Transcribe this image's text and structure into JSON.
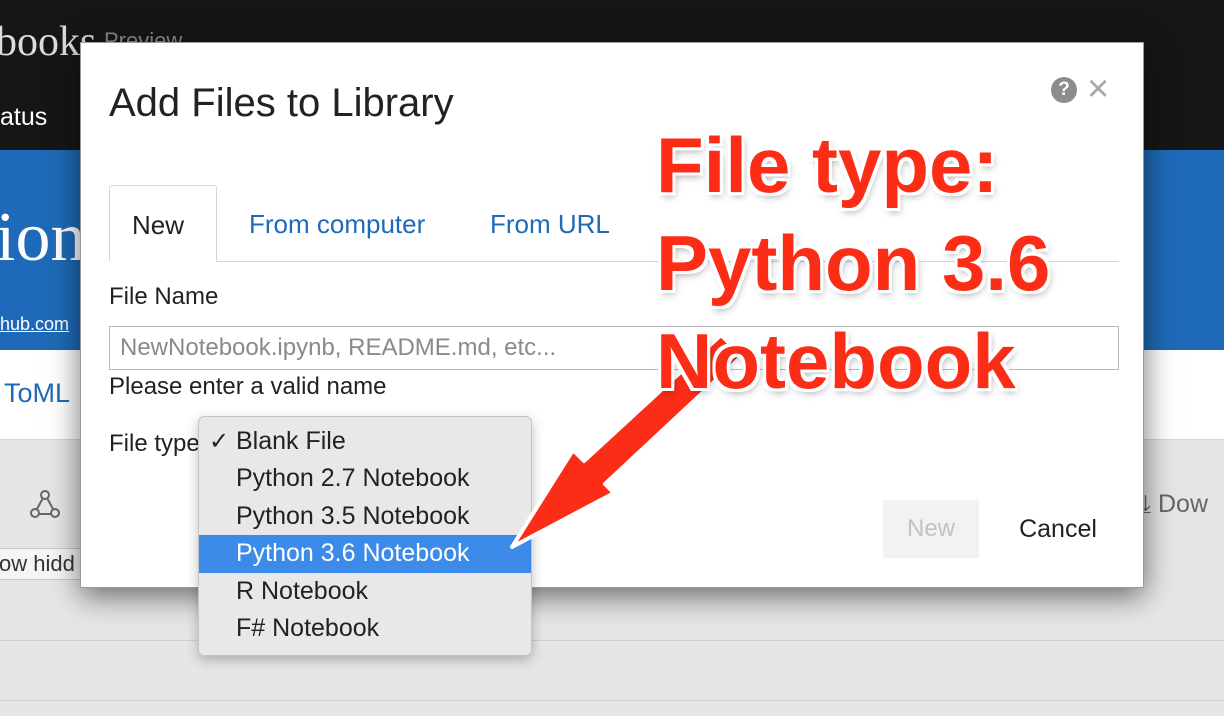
{
  "background": {
    "brand": "books",
    "preview": "Preview",
    "nav_status": "atus",
    "hero_title": "ion",
    "hero_link": "hub.com",
    "project_name": "ToML",
    "show_hidden": "ow hidd",
    "download": "Dow"
  },
  "modal": {
    "title": "Add Files to Library",
    "help_icon": "?",
    "close_icon": "×",
    "tabs": [
      {
        "label": "New"
      },
      {
        "label": "From computer"
      },
      {
        "label": "From URL"
      }
    ],
    "file_name_label": "File Name",
    "file_name_placeholder": "NewNotebook.ipynb, README.md, etc...",
    "file_name_value": "",
    "error_message": "Please enter a valid name",
    "file_type_label": "File type",
    "new_button": "New",
    "cancel_button": "Cancel"
  },
  "dropdown": {
    "check_mark": "✓",
    "checked_item": "Blank File",
    "highlighted_item": "Python 3.6 Notebook",
    "options": [
      "Blank File",
      "Python 2.7 Notebook",
      "Python 3.5 Notebook",
      "Python 3.6 Notebook",
      "R Notebook",
      "F# Notebook"
    ]
  },
  "annotation": {
    "lines": [
      "File type:",
      "Python 3.6",
      "Notebook"
    ],
    "color": "#fb2d17"
  },
  "colors": {
    "accent": "#1f6ab8",
    "selection": "#3d8be8"
  }
}
